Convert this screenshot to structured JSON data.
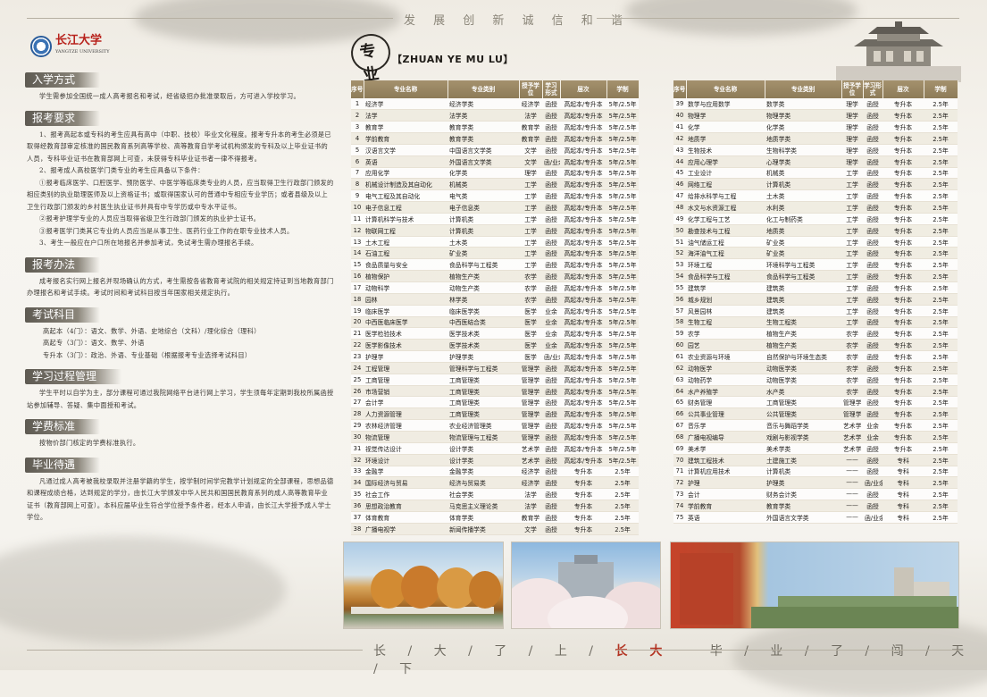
{
  "slogans": {
    "top": "发 展  创 新  诚 信  和 谐",
    "bottom_a": "长 / 大 / 了 / 上",
    "bottom_red": "长 大",
    "bottom_b": "毕 / 业 / 了 / 闯 / 天 / 下"
  },
  "logo": {
    "name": "长江大学",
    "sub": "YANGTZE UNIVERSITY"
  },
  "sections": [
    {
      "title": "入学方式",
      "paras": [
        "学生需参加全国统一成人高考报名和考试，经省级招办批准录取后，方可进入学校学习。"
      ]
    },
    {
      "title": "报考要求",
      "paras": [
        "1、报考高起本或专科的考生应具有高中（中职、技校）毕业文化程度。报考专升本的考生必须是已取得经教育部审定核准的国民教育系列高等学校、高等教育自学考试机构颁发的专科及以上毕业证书的人员，专科毕业证书在教育部网上可查，未获得专科毕业证书者一律不得报考。",
        "2、报考成人高校医学门类专业的考生应具备以下条件：",
        "①报考临床医学、口腔医学、预防医学、中医学等临床类专业的人员，应当取得卫生行政部门颁发的相应类别的执业助理医师及以上资格证书；或取得国家认可的普通中专相应专业学历；或者县级及以上卫生行政部门颁发的乡村医生执业证书并具有中专学历或中专水平证书。",
        "②报考护理学专业的人员应当取得省级卫生行政部门颁发的执业护士证书。",
        "③报考医学门类其它专业的人员应当是从事卫生、医药行业工作的在职专业技术人员。",
        "3、考生一般应在户口所在地报名并参加考试，免试考生需办理报名手续。"
      ]
    },
    {
      "title": "报考办法",
      "paras": [
        "成考报名实行网上报名并现场确认的方式，考生需按各省教育考试院的相关规定持证到当地教育部门办理报名和考试手续。考试时间和考试科目按当年国家相关规定执行。"
      ]
    },
    {
      "title": "考试科目",
      "lines": [
        "高起本（4门）：语文、数学、外语、史地综合（文科）/理化综合（理科）",
        "高起专（3门）：语文、数学、外语",
        "专升本（3门）：政治、外语、专业基础（根据报考专业选择考试科目）"
      ]
    },
    {
      "title": "学习过程管理",
      "paras": [
        "学生平时以自学为主，部分课程可通过我院网络平台进行网上学习，学生须每年定期到我校所属函授站参加辅导、答疑、集中面授和考试。"
      ]
    },
    {
      "title": "学费标准",
      "paras": [
        "按物价部门核定的学费标准执行。"
      ]
    },
    {
      "title": "毕业待遇",
      "paras": [
        "凡通过成人高考被我校录取并注册学籍的学生，按学制时间学完教学计划规定的全部课程，思想品德和课程成绩合格，达到规定的学分，由长江大学颁发中华人民共和国国民教育系列的成人高等教育毕业证书（教育部网上可查）。本科应届毕业生符合学位授予条件者，经本人申请，由长江大学授予成人学士学位。"
      ]
    }
  ],
  "majors_title": {
    "brush": "专业",
    "sub": "目录",
    "text": "【ZHUAN YE MU LU】"
  },
  "table_headers": [
    "序号",
    "专业名称",
    "专业类别",
    "授予学位",
    "学习形式",
    "层次",
    "学制"
  ],
  "left_rows": [
    [
      "1",
      "经济学",
      "经济学类",
      "经济学",
      "函授",
      "高起本/专升本",
      "5年/2.5年"
    ],
    [
      "2",
      "法学",
      "法学类",
      "法学",
      "函授",
      "高起本/专升本",
      "5年/2.5年"
    ],
    [
      "3",
      "教育学",
      "教育学类",
      "教育学",
      "函授",
      "高起本/专升本",
      "5年/2.5年"
    ],
    [
      "4",
      "学前教育",
      "教育学类",
      "教育学",
      "函授",
      "高起本/专升本",
      "5年/2.5年"
    ],
    [
      "5",
      "汉语言文学",
      "中国语言文学类",
      "文学",
      "函授",
      "高起本/专升本",
      "5年/2.5年"
    ],
    [
      "6",
      "英语",
      "外国语言文学类",
      "文学",
      "函/业余",
      "高起本/专升本",
      "5年/2.5年"
    ],
    [
      "7",
      "应用化学",
      "化学类",
      "理学",
      "函授",
      "高起本/专升本",
      "5年/2.5年"
    ],
    [
      "8",
      "机械设计制造及其自动化",
      "机械类",
      "工学",
      "函授",
      "高起本/专升本",
      "5年/2.5年"
    ],
    [
      "9",
      "电气工程及其自动化",
      "电气类",
      "工学",
      "函授",
      "高起本/专升本",
      "5年/2.5年"
    ],
    [
      "10",
      "电子信息工程",
      "电子信息类",
      "工学",
      "函授",
      "高起本/专升本",
      "5年/2.5年"
    ],
    [
      "11",
      "计算机科学与技术",
      "计算机类",
      "工学",
      "函授",
      "高起本/专升本",
      "5年/2.5年"
    ],
    [
      "12",
      "物联网工程",
      "计算机类",
      "工学",
      "函授",
      "高起本/专升本",
      "5年/2.5年"
    ],
    [
      "13",
      "土木工程",
      "土木类",
      "工学",
      "函授",
      "高起本/专升本",
      "5年/2.5年"
    ],
    [
      "14",
      "石油工程",
      "矿业类",
      "工学",
      "函授",
      "高起本/专升本",
      "5年/2.5年"
    ],
    [
      "15",
      "食品质量与安全",
      "食品科学与工程类",
      "工学",
      "函授",
      "高起本/专升本",
      "5年/2.5年"
    ],
    [
      "16",
      "植物保护",
      "植物生产类",
      "农学",
      "函授",
      "高起本/专升本",
      "5年/2.5年"
    ],
    [
      "17",
      "动物科学",
      "动物生产类",
      "农学",
      "函授",
      "高起本/专升本",
      "5年/2.5年"
    ],
    [
      "18",
      "园林",
      "林学类",
      "农学",
      "函授",
      "高起本/专升本",
      "5年/2.5年"
    ],
    [
      "19",
      "临床医学",
      "临床医学类",
      "医学",
      "业余",
      "高起本/专升本",
      "5年/2.5年"
    ],
    [
      "20",
      "中西医临床医学",
      "中西医结合类",
      "医学",
      "业余",
      "高起本/专升本",
      "5年/2.5年"
    ],
    [
      "21",
      "医学检验技术",
      "医学技术类",
      "医学",
      "业余",
      "高起本/专升本",
      "5年/2.5年"
    ],
    [
      "22",
      "医学影像技术",
      "医学技术类",
      "医学",
      "业余",
      "高起本/专升本",
      "5年/2.5年"
    ],
    [
      "23",
      "护理学",
      "护理学类",
      "医学",
      "函/业余",
      "高起本/专升本",
      "5年/2.5年"
    ],
    [
      "24",
      "工程管理",
      "管理科学与工程类",
      "管理学",
      "函授",
      "高起本/专升本",
      "5年/2.5年"
    ],
    [
      "25",
      "工商管理",
      "工商管理类",
      "管理学",
      "函授",
      "高起本/专升本",
      "5年/2.5年"
    ],
    [
      "26",
      "市场营销",
      "工商管理类",
      "管理学",
      "函授",
      "高起本/专升本",
      "5年/2.5年"
    ],
    [
      "27",
      "会计学",
      "工商管理类",
      "管理学",
      "函授",
      "高起本/专升本",
      "5年/2.5年"
    ],
    [
      "28",
      "人力资源管理",
      "工商管理类",
      "管理学",
      "函授",
      "高起本/专升本",
      "5年/2.5年"
    ],
    [
      "29",
      "农林经济管理",
      "农业经济管理类",
      "管理学",
      "函授",
      "高起本/专升本",
      "5年/2.5年"
    ],
    [
      "30",
      "物流管理",
      "物流管理与工程类",
      "管理学",
      "函授",
      "高起本/专升本",
      "5年/2.5年"
    ],
    [
      "31",
      "视觉传达设计",
      "设计学类",
      "艺术学",
      "函授",
      "高起本/专升本",
      "5年/2.5年"
    ],
    [
      "32",
      "环境设计",
      "设计学类",
      "艺术学",
      "函授",
      "高起本/专升本",
      "5年/2.5年"
    ],
    [
      "33",
      "金融学",
      "金融学类",
      "经济学",
      "函授",
      "专升本",
      "2.5年"
    ],
    [
      "34",
      "国际经济与贸易",
      "经济与贸易类",
      "经济学",
      "函授",
      "专升本",
      "2.5年"
    ],
    [
      "35",
      "社会工作",
      "社会学类",
      "法学",
      "函授",
      "专升本",
      "2.5年"
    ],
    [
      "36",
      "思想政治教育",
      "马克思主义理论类",
      "法学",
      "函授",
      "专升本",
      "2.5年"
    ],
    [
      "37",
      "体育教育",
      "体育学类",
      "教育学",
      "函授",
      "专升本",
      "2.5年"
    ],
    [
      "38",
      "广播电视学",
      "新闻传播学类",
      "文学",
      "函授",
      "专升本",
      "2.5年"
    ]
  ],
  "right_rows": [
    [
      "39",
      "数学与应用数学",
      "数学类",
      "理学",
      "函授",
      "专升本",
      "2.5年"
    ],
    [
      "40",
      "物理学",
      "物理学类",
      "理学",
      "函授",
      "专升本",
      "2.5年"
    ],
    [
      "41",
      "化学",
      "化学类",
      "理学",
      "函授",
      "专升本",
      "2.5年"
    ],
    [
      "42",
      "地质学",
      "地质学类",
      "理学",
      "函授",
      "专升本",
      "2.5年"
    ],
    [
      "43",
      "生物技术",
      "生物科学类",
      "理学",
      "函授",
      "专升本",
      "2.5年"
    ],
    [
      "44",
      "应用心理学",
      "心理学类",
      "理学",
      "函授",
      "专升本",
      "2.5年"
    ],
    [
      "45",
      "工业设计",
      "机械类",
      "工学",
      "函授",
      "专升本",
      "2.5年"
    ],
    [
      "46",
      "网络工程",
      "计算机类",
      "工学",
      "函授",
      "专升本",
      "2.5年"
    ],
    [
      "47",
      "给排水科学与工程",
      "土木类",
      "工学",
      "函授",
      "专升本",
      "2.5年"
    ],
    [
      "48",
      "水文与水资源工程",
      "水利类",
      "工学",
      "函授",
      "专升本",
      "2.5年"
    ],
    [
      "49",
      "化学工程与工艺",
      "化工与制药类",
      "工学",
      "函授",
      "专升本",
      "2.5年"
    ],
    [
      "50",
      "勘查技术与工程",
      "地质类",
      "工学",
      "函授",
      "专升本",
      "2.5年"
    ],
    [
      "51",
      "油气储运工程",
      "矿业类",
      "工学",
      "函授",
      "专升本",
      "2.5年"
    ],
    [
      "52",
      "海洋油气工程",
      "矿业类",
      "工学",
      "函授",
      "专升本",
      "2.5年"
    ],
    [
      "53",
      "环境工程",
      "环境科学与工程类",
      "工学",
      "函授",
      "专升本",
      "2.5年"
    ],
    [
      "54",
      "食品科学与工程",
      "食品科学与工程类",
      "工学",
      "函授",
      "专升本",
      "2.5年"
    ],
    [
      "55",
      "建筑学",
      "建筑类",
      "工学",
      "函授",
      "专升本",
      "2.5年"
    ],
    [
      "56",
      "城乡规划",
      "建筑类",
      "工学",
      "函授",
      "专升本",
      "2.5年"
    ],
    [
      "57",
      "风景园林",
      "建筑类",
      "工学",
      "函授",
      "专升本",
      "2.5年"
    ],
    [
      "58",
      "生物工程",
      "生物工程类",
      "工学",
      "函授",
      "专升本",
      "2.5年"
    ],
    [
      "59",
      "农学",
      "植物生产类",
      "农学",
      "函授",
      "专升本",
      "2.5年"
    ],
    [
      "60",
      "园艺",
      "植物生产类",
      "农学",
      "函授",
      "专升本",
      "2.5年"
    ],
    [
      "61",
      "农业资源与环境",
      "自然保护与环境生态类",
      "农学",
      "函授",
      "专升本",
      "2.5年"
    ],
    [
      "62",
      "动物医学",
      "动物医学类",
      "农学",
      "函授",
      "专升本",
      "2.5年"
    ],
    [
      "63",
      "动物药学",
      "动物医学类",
      "农学",
      "函授",
      "专升本",
      "2.5年"
    ],
    [
      "64",
      "水产养殖学",
      "水产类",
      "农学",
      "函授",
      "专升本",
      "2.5年"
    ],
    [
      "65",
      "财务管理",
      "工商管理类",
      "管理学",
      "函授",
      "专升本",
      "2.5年"
    ],
    [
      "66",
      "公共事业管理",
      "公共管理类",
      "管理学",
      "函授",
      "专升本",
      "2.5年"
    ],
    [
      "67",
      "音乐学",
      "音乐与舞蹈学类",
      "艺术学",
      "业余",
      "专升本",
      "2.5年"
    ],
    [
      "68",
      "广播电视编导",
      "戏剧与影视学类",
      "艺术学",
      "业余",
      "专升本",
      "2.5年"
    ],
    [
      "69",
      "美术学",
      "美术学类",
      "艺术学",
      "函授",
      "专升本",
      "2.5年"
    ],
    [
      "70",
      "建筑工程技术",
      "土建施工类",
      "——",
      "函授",
      "专科",
      "2.5年"
    ],
    [
      "71",
      "计算机应用技术",
      "计算机类",
      "——",
      "函授",
      "专科",
      "2.5年"
    ],
    [
      "72",
      "护理",
      "护理类",
      "——",
      "函/业余",
      "专科",
      "2.5年"
    ],
    [
      "73",
      "会计",
      "财务会计类",
      "——",
      "函授",
      "专科",
      "2.5年"
    ],
    [
      "74",
      "学前教育",
      "教育学类",
      "——",
      "函授",
      "专科",
      "2.5年"
    ],
    [
      "75",
      "英语",
      "外国语言文学类",
      "——",
      "函/业余",
      "专科",
      "2.5年"
    ]
  ]
}
